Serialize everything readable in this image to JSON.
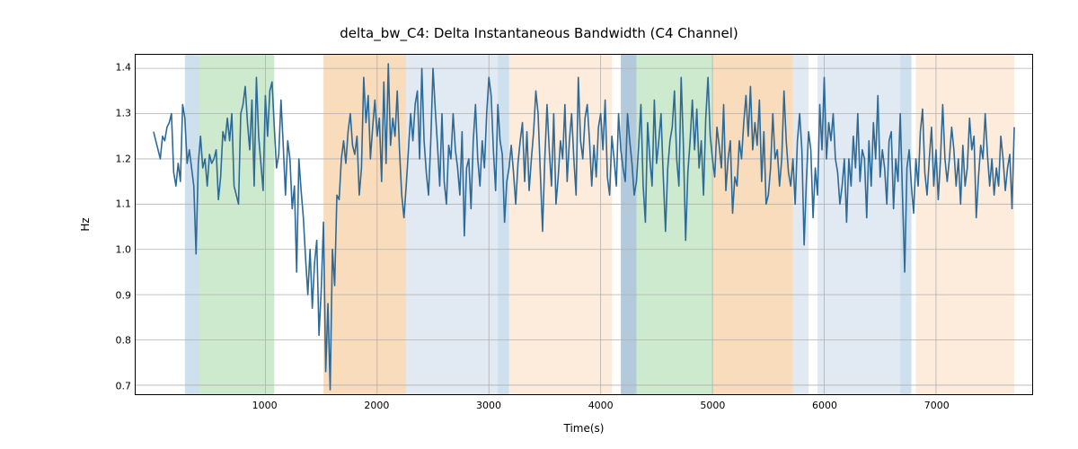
{
  "chart_data": {
    "type": "line",
    "title": "delta_bw_C4: Delta Instantaneous Bandwidth (C4 Channel)",
    "xlabel": "Time(s)",
    "ylabel": "Hz",
    "xlim": [
      0,
      7700
    ],
    "ylim": [
      0.68,
      1.43
    ],
    "xticks": [
      1000,
      2000,
      3000,
      4000,
      5000,
      6000,
      7000
    ],
    "yticks": [
      0.7,
      0.8,
      0.9,
      1.0,
      1.1,
      1.2,
      1.3,
      1.4
    ],
    "xtick_labels": [
      "1000",
      "2000",
      "3000",
      "4000",
      "5000",
      "6000",
      "7000"
    ],
    "ytick_labels": [
      "0.7",
      "0.8",
      "0.9",
      "1.0",
      "1.1",
      "1.2",
      "1.3",
      "1.4"
    ],
    "bands": [
      {
        "x0": 280,
        "x1": 410,
        "color": "#a6c6e0",
        "alpha": 0.55
      },
      {
        "x0": 410,
        "x1": 1080,
        "color": "#a6d8a6",
        "alpha": 0.55
      },
      {
        "x0": 1520,
        "x1": 2260,
        "color": "#f5c58f",
        "alpha": 0.6
      },
      {
        "x0": 2260,
        "x1": 3080,
        "color": "#c9d7e9",
        "alpha": 0.55
      },
      {
        "x0": 3080,
        "x1": 3180,
        "color": "#a6c6e0",
        "alpha": 0.55
      },
      {
        "x0": 3180,
        "x1": 4100,
        "color": "#fbe0c3",
        "alpha": 0.6
      },
      {
        "x0": 4180,
        "x1": 4320,
        "color": "#88aec9",
        "alpha": 0.65
      },
      {
        "x0": 4320,
        "x1": 5000,
        "color": "#a6d8a6",
        "alpha": 0.55
      },
      {
        "x0": 5000,
        "x1": 5140,
        "color": "#f5c58f",
        "alpha": 0.6
      },
      {
        "x0": 5140,
        "x1": 5720,
        "color": "#f5c58f",
        "alpha": 0.6
      },
      {
        "x0": 5720,
        "x1": 5860,
        "color": "#c9d7e9",
        "alpha": 0.55
      },
      {
        "x0": 5940,
        "x1": 6680,
        "color": "#c9d7e9",
        "alpha": 0.55
      },
      {
        "x0": 6680,
        "x1": 6780,
        "color": "#a6c6e0",
        "alpha": 0.55
      },
      {
        "x0": 6820,
        "x1": 7700,
        "color": "#fbe0c3",
        "alpha": 0.6
      }
    ],
    "series": [
      {
        "name": "delta_bw_C4",
        "color": "#2d6a98",
        "x_step": 20,
        "values": [
          1.26,
          1.24,
          1.22,
          1.2,
          1.25,
          1.24,
          1.27,
          1.28,
          1.3,
          1.17,
          1.14,
          1.19,
          1.15,
          1.32,
          1.29,
          1.19,
          1.22,
          1.18,
          1.14,
          0.99,
          1.19,
          1.25,
          1.18,
          1.2,
          1.14,
          1.21,
          1.19,
          1.2,
          1.22,
          1.11,
          1.16,
          1.26,
          1.24,
          1.29,
          1.24,
          1.3,
          1.14,
          1.12,
          1.1,
          1.3,
          1.32,
          1.36,
          1.28,
          1.22,
          1.33,
          1.14,
          1.38,
          1.25,
          1.19,
          1.13,
          1.34,
          1.25,
          1.35,
          1.37,
          1.27,
          1.18,
          1.21,
          1.33,
          1.23,
          1.12,
          1.24,
          1.2,
          1.09,
          1.14,
          0.95,
          1.2,
          1.13,
          1.07,
          0.98,
          0.9,
          1.0,
          0.87,
          0.97,
          1.02,
          0.81,
          0.91,
          1.06,
          0.73,
          0.88,
          0.69,
          1.0,
          0.92,
          1.12,
          1.11,
          1.2,
          1.24,
          1.19,
          1.26,
          1.3,
          1.23,
          1.21,
          1.25,
          1.12,
          1.18,
          1.38,
          1.28,
          1.34,
          1.2,
          1.27,
          1.33,
          1.25,
          1.29,
          1.15,
          1.37,
          1.19,
          1.41,
          1.23,
          1.29,
          1.25,
          1.35,
          1.22,
          1.12,
          1.07,
          1.14,
          1.22,
          1.3,
          1.24,
          1.32,
          1.35,
          1.2,
          1.4,
          1.24,
          1.17,
          1.12,
          1.24,
          1.4,
          1.31,
          1.23,
          1.14,
          1.3,
          1.15,
          1.1,
          1.23,
          1.2,
          1.3,
          1.22,
          1.18,
          1.12,
          1.26,
          1.03,
          1.18,
          1.2,
          1.09,
          1.24,
          1.32,
          1.2,
          1.14,
          1.24,
          1.18,
          1.3,
          1.38,
          1.34,
          1.22,
          1.13,
          1.32,
          1.24,
          1.21,
          1.06,
          1.15,
          1.18,
          1.23,
          1.17,
          1.1,
          1.19,
          1.24,
          1.28,
          1.15,
          1.26,
          1.13,
          1.2,
          1.26,
          1.35,
          1.3,
          1.17,
          1.04,
          1.2,
          1.32,
          1.22,
          1.14,
          1.3,
          1.1,
          1.16,
          1.24,
          1.2,
          1.32,
          1.15,
          1.24,
          1.3,
          1.2,
          1.12,
          1.38,
          1.24,
          1.2,
          1.29,
          1.32,
          1.24,
          1.14,
          1.23,
          1.16,
          1.27,
          1.3,
          1.22,
          1.33,
          1.16,
          1.12,
          1.25,
          1.2,
          1.14,
          1.3,
          1.22,
          1.18,
          1.15,
          1.3,
          1.24,
          1.19,
          1.12,
          1.15,
          1.23,
          1.32,
          1.14,
          1.06,
          1.28,
          1.2,
          1.14,
          1.33,
          1.19,
          1.24,
          1.3,
          1.16,
          1.04,
          1.18,
          1.24,
          1.27,
          1.35,
          1.2,
          1.14,
          1.38,
          1.23,
          1.02,
          1.17,
          1.24,
          1.33,
          1.22,
          1.31,
          1.18,
          1.24,
          1.12,
          1.29,
          1.38,
          1.25,
          1.2,
          1.16,
          1.27,
          1.23,
          1.18,
          1.32,
          1.13,
          1.2,
          1.24,
          1.08,
          1.16,
          1.14,
          1.24,
          1.2,
          1.28,
          1.34,
          1.25,
          1.36,
          1.22,
          1.28,
          1.23,
          1.33,
          1.15,
          1.26,
          1.1,
          1.12,
          1.18,
          1.3,
          1.2,
          1.22,
          1.14,
          1.2,
          1.35,
          1.24,
          1.17,
          1.14,
          1.2,
          1.1,
          1.24,
          1.3,
          1.22,
          1.01,
          1.15,
          1.26,
          1.22,
          1.07,
          1.18,
          1.12,
          1.32,
          1.22,
          1.38,
          1.2,
          1.28,
          1.24,
          1.3,
          1.2,
          1.17,
          1.1,
          1.14,
          1.2,
          1.06,
          1.2,
          1.14,
          1.25,
          1.18,
          1.3,
          1.15,
          1.22,
          1.2,
          1.07,
          1.24,
          1.14,
          1.28,
          1.2,
          1.34,
          1.16,
          1.22,
          1.18,
          1.1,
          1.24,
          1.26,
          1.09,
          1.2,
          1.15,
          1.3,
          1.12,
          0.95,
          1.18,
          1.22,
          1.14,
          1.08,
          1.2,
          1.14,
          1.26,
          1.31,
          1.17,
          1.12,
          1.2,
          1.27,
          1.14,
          1.22,
          1.11,
          1.2,
          1.32,
          1.2,
          1.15,
          1.2,
          1.27,
          1.22,
          1.14,
          1.2,
          1.1,
          1.23,
          1.14,
          1.18,
          1.29,
          1.22,
          1.25,
          1.07,
          1.16,
          1.23,
          1.2,
          1.3,
          1.21,
          1.14,
          1.2,
          1.12,
          1.18,
          1.14,
          1.25,
          1.2,
          1.13,
          1.18,
          1.21,
          1.09,
          1.27
        ]
      }
    ]
  }
}
